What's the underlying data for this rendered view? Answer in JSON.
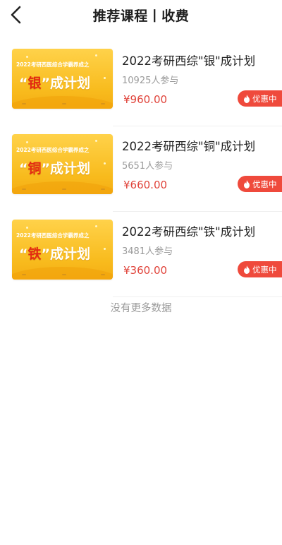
{
  "header": {
    "title": "推荐课程丨收费",
    "back_icon": "chevron-left-icon"
  },
  "courses": [
    {
      "thumb_sub": "2022考研西医综合学霸养成之",
      "thumb_highlight": "银",
      "thumb_suffix": "成计划",
      "title": "2022考研西综\"银\"成计划",
      "participants": "10925人参与",
      "price": "¥960.00",
      "badge": "优惠中"
    },
    {
      "thumb_sub": "2022考研西医综合学霸养成之",
      "thumb_highlight": "铜",
      "thumb_suffix": "成计划",
      "title": "2022考研西综\"铜\"成计划",
      "participants": "5651人参与",
      "price": "¥660.00",
      "badge": "优惠中"
    },
    {
      "thumb_sub": "2022考研西医综合学霸养成之",
      "thumb_highlight": "铁",
      "thumb_suffix": "成计划",
      "title": "2022考研西综\"铁\"成计划",
      "participants": "3481人参与",
      "price": "¥360.00",
      "badge": "优惠中"
    }
  ],
  "footer_note": "没有更多数据",
  "colors": {
    "accent_red": "#ef4a3c",
    "price_red": "#e0433a",
    "thumb_yellow": "#f8bb1d"
  }
}
